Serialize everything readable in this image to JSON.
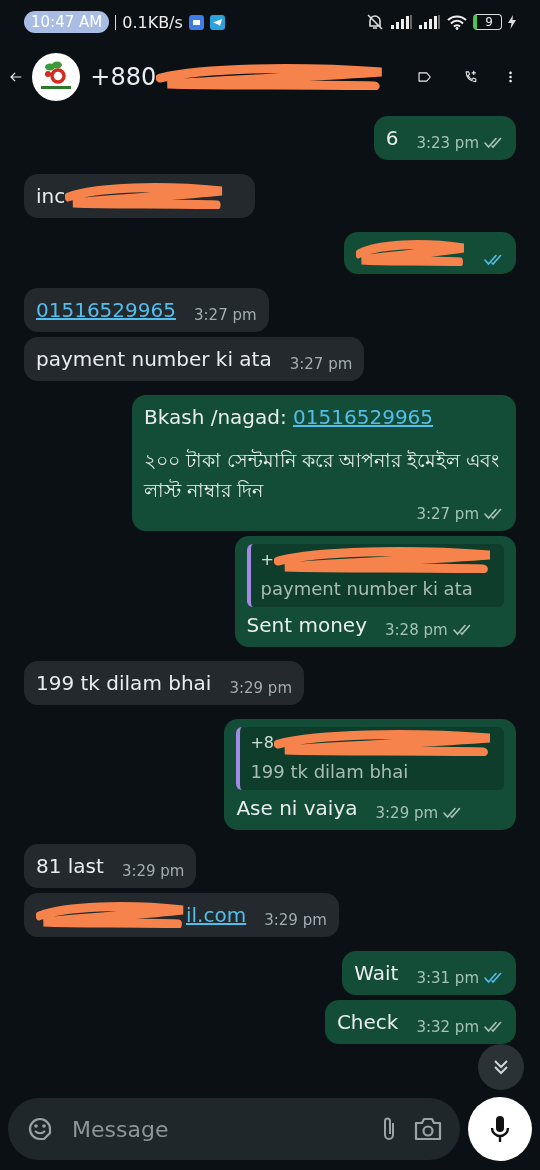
{
  "status_bar": {
    "time": "10:47 AM",
    "speed": "0.1KB/s",
    "battery": "9"
  },
  "header": {
    "title": "+880"
  },
  "messages": [
    {
      "kind": "out",
      "text": "6",
      "time": "3:23 pm",
      "read": false
    },
    {
      "kind": "in",
      "text": "inc",
      "redacted": true
    },
    {
      "kind": "out",
      "read": true,
      "redacted": true
    },
    {
      "kind": "in",
      "link": "01516529965",
      "time": "3:27 pm"
    },
    {
      "kind": "in",
      "text": "payment number ki ata",
      "time": "3:27 pm"
    },
    {
      "kind": "out",
      "text": "Bkash /nagad: ",
      "link": "01516529965",
      "body": "২০০ টাকা সেন্টমানি করে আপনার ইমেইল এবং লাস্ট নাম্বার দিন",
      "time": "3:27 pm",
      "read": false
    },
    {
      "kind": "out",
      "quote": {
        "sender": "+",
        "text": "payment number ki ata"
      },
      "text": "Sent money",
      "time": "3:28 pm",
      "read": false
    },
    {
      "kind": "in",
      "text": "199 tk dilam bhai",
      "time": "3:29 pm"
    },
    {
      "kind": "out",
      "quote": {
        "sender": "+8",
        "text": "199 tk dilam bhai"
      },
      "text": "Ase ni vaiya",
      "time": "3:29 pm",
      "read": false
    },
    {
      "kind": "in",
      "text": "81 last",
      "time": "3:29 pm"
    },
    {
      "kind": "in",
      "link": "il.com",
      "time": "3:29 pm",
      "redacted": true
    },
    {
      "kind": "out",
      "text": "Wait",
      "time": "3:31 pm",
      "read": true
    },
    {
      "kind": "out",
      "text": "Check",
      "time": "3:32 pm",
      "read": false
    }
  ],
  "composer": {
    "placeholder": "Message"
  }
}
